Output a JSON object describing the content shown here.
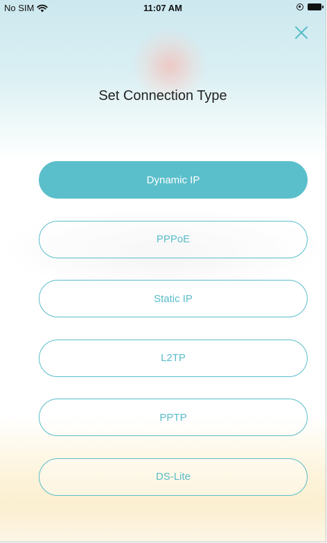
{
  "status_bar": {
    "carrier": "No SIM",
    "time": "11:07 AM"
  },
  "title": "Set Connection Type",
  "icons": {
    "close": "close-icon",
    "wifi": "wifi-icon",
    "orientation_lock": "orientation-lock-icon",
    "battery": "battery-icon"
  },
  "colors": {
    "accent": "#5bbfcb",
    "title_text": "#222222"
  },
  "options": [
    {
      "label": "Dynamic IP",
      "selected": true
    },
    {
      "label": "PPPoE",
      "selected": false
    },
    {
      "label": "Static IP",
      "selected": false
    },
    {
      "label": "L2TP",
      "selected": false
    },
    {
      "label": "PPTP",
      "selected": false
    },
    {
      "label": "DS-Lite",
      "selected": false
    }
  ]
}
